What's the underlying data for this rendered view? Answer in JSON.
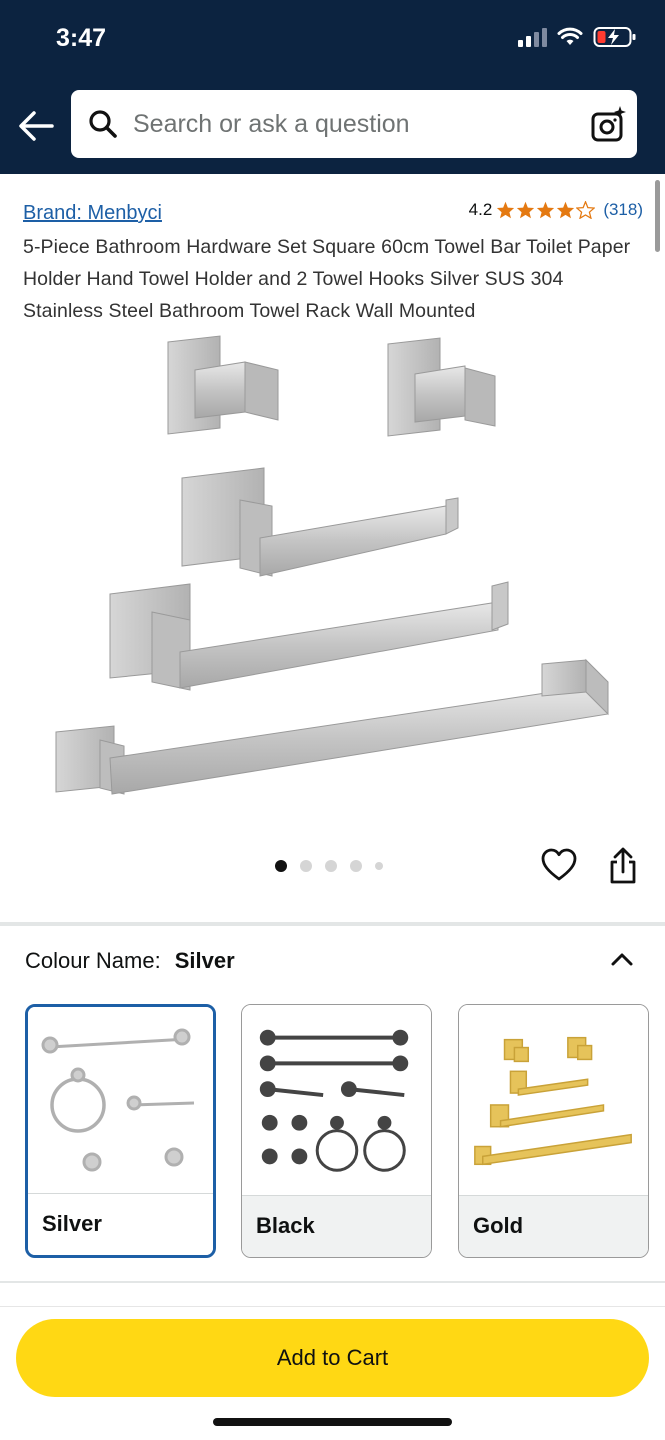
{
  "status_bar": {
    "time": "3:47"
  },
  "search": {
    "placeholder": "Search or ask a question"
  },
  "product": {
    "brand": "Brand: Menbyci",
    "rating": "4.2",
    "rating_value": 4.2,
    "rating_count": "(318)",
    "title": "5-Piece Bathroom Hardware Set Square 60cm Towel Bar Toilet Paper Holder Hand Towel Holder and 2 Towel Hooks Silver SUS 304 Stainless Steel Bathroom Towel Rack Wall Mounted",
    "image_count": 5,
    "active_image_index": 0
  },
  "variation": {
    "label": "Colour Name:",
    "selected": "Silver",
    "options": [
      {
        "label": "Silver"
      },
      {
        "label": "Black"
      },
      {
        "label": "Gold"
      }
    ]
  },
  "cta": {
    "add_to_cart": "Add to Cart"
  },
  "colors": {
    "header_bg": "#0c2340",
    "star": "#e47911",
    "link": "#1d5fa6",
    "cart_button": "#ffd814",
    "selected_border": "#1d5fa6"
  }
}
